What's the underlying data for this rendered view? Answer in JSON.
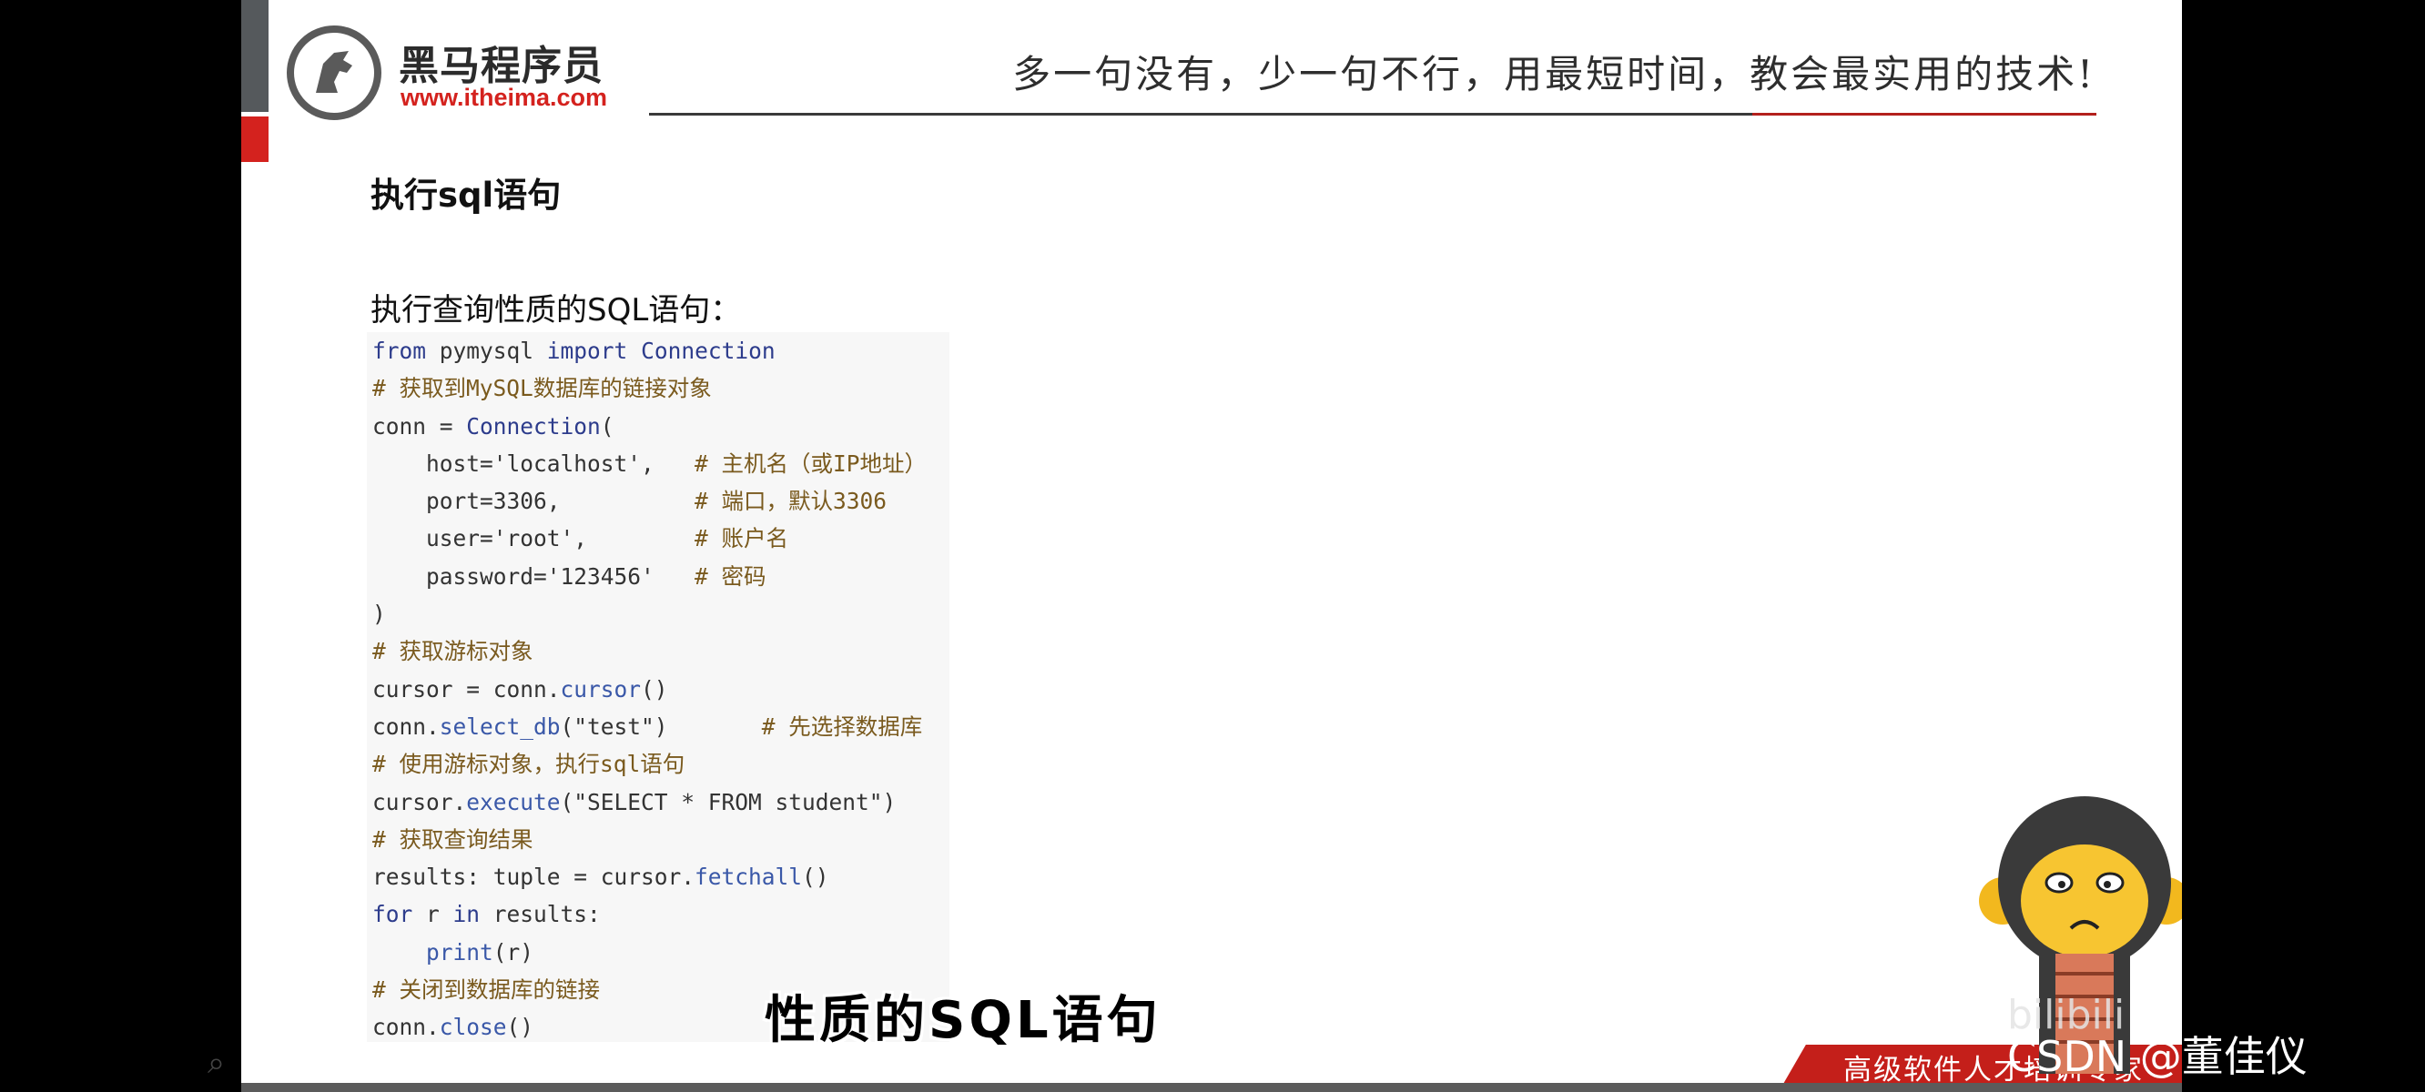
{
  "header": {
    "logo_cn": "黑马程序员",
    "logo_url": "www.itheima.com",
    "slogan": "多一句没有，少一句不行，用最短时间，教会最实用的技术!"
  },
  "section_title": "执行sql语句",
  "subtitle": "执行查询性质的SQL语句：",
  "code": {
    "lines": [
      [
        {
          "t": "from",
          "c": "kw"
        },
        {
          "t": " pymysql ",
          "c": ""
        },
        {
          "t": "import",
          "c": "kw"
        },
        {
          "t": " ",
          "c": ""
        },
        {
          "t": "Connection",
          "c": "kw"
        }
      ],
      [
        {
          "t": "# 获取到MySQL数据库的链接对象",
          "c": "cm"
        }
      ],
      [
        {
          "t": "conn = ",
          "c": ""
        },
        {
          "t": "Connection",
          "c": "kw"
        },
        {
          "t": "(",
          "c": ""
        }
      ],
      [
        {
          "t": "    host='localhost',   ",
          "c": ""
        },
        {
          "t": "# 主机名（或IP地址）",
          "c": "cm"
        }
      ],
      [
        {
          "t": "    port=3306,          ",
          "c": ""
        },
        {
          "t": "# 端口，默认3306",
          "c": "cm"
        }
      ],
      [
        {
          "t": "    user='root',        ",
          "c": ""
        },
        {
          "t": "# 账户名",
          "c": "cm"
        }
      ],
      [
        {
          "t": "    password='123456'   ",
          "c": ""
        },
        {
          "t": "# 密码",
          "c": "cm"
        }
      ],
      [
        {
          "t": ")",
          "c": ""
        }
      ],
      [
        {
          "t": "# 获取游标对象",
          "c": "cm"
        }
      ],
      [
        {
          "t": "cursor = conn.",
          "c": ""
        },
        {
          "t": "cursor",
          "c": "fn"
        },
        {
          "t": "()",
          "c": ""
        }
      ],
      [
        {
          "t": "conn.",
          "c": ""
        },
        {
          "t": "select_db",
          "c": "fn"
        },
        {
          "t": "(\"test\")       ",
          "c": ""
        },
        {
          "t": "# 先选择数据库",
          "c": "cm"
        }
      ],
      [
        {
          "t": "# 使用游标对象，执行sql语句",
          "c": "cm"
        }
      ],
      [
        {
          "t": "cursor.",
          "c": ""
        },
        {
          "t": "execute",
          "c": "fn"
        },
        {
          "t": "(\"SELECT * FROM student\")",
          "c": ""
        }
      ],
      [
        {
          "t": "# 获取查询结果",
          "c": "cm"
        }
      ],
      [
        {
          "t": "results: tuple = cursor.",
          "c": ""
        },
        {
          "t": "fetchall",
          "c": "fn"
        },
        {
          "t": "()",
          "c": ""
        }
      ],
      [
        {
          "t": "for",
          "c": "kw"
        },
        {
          "t": " r ",
          "c": ""
        },
        {
          "t": "in",
          "c": "kw"
        },
        {
          "t": " results:",
          "c": ""
        }
      ],
      [
        {
          "t": "    ",
          "c": ""
        },
        {
          "t": "print",
          "c": "fn"
        },
        {
          "t": "(r)",
          "c": ""
        }
      ],
      [
        {
          "t": "# 关闭到数据库的链接",
          "c": "cm"
        }
      ],
      [
        {
          "t": "conn.",
          "c": ""
        },
        {
          "t": "close",
          "c": "fn"
        },
        {
          "t": "()",
          "c": ""
        }
      ]
    ]
  },
  "caption": "性质的SQL语句",
  "footer_banner": "高级软件人才培训专家",
  "watermark": "CSDN @董佳仪",
  "bili_logo": "bilibili",
  "colors": {
    "brand_red": "#d4221e",
    "code_bg": "#f7f7f7",
    "keyword": "#2d3c8c",
    "comment": "#7a5a1e"
  }
}
